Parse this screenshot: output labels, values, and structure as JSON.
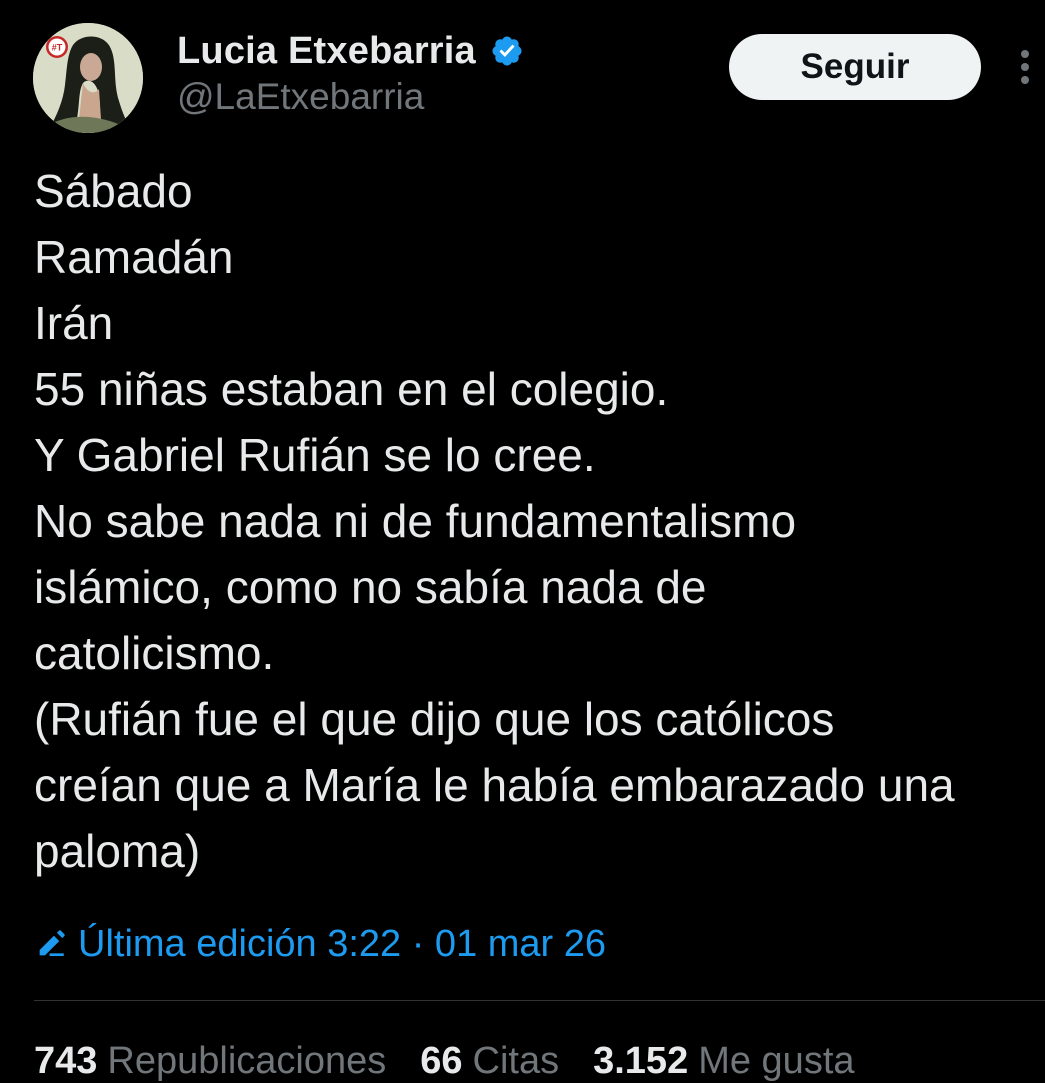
{
  "author": {
    "display_name": "Lucia Etxebarria",
    "handle": "@LaEtxebarria",
    "verified": true,
    "avatar_badge": "#T"
  },
  "actions": {
    "follow_label": "Seguir",
    "more_icon": "more-vertical-icon"
  },
  "tweet": {
    "lines": [
      "Sábado",
      "Ramadán",
      "Irán",
      "55 niñas estaban en el colegio.",
      "Y Gabriel Rufián se lo cree.",
      "No sabe nada ni de fundamentalismo",
      "islámico, como no sabía nada de",
      "catolicismo.",
      "(Rufián fue el que dijo que los católicos",
      "creían que a María le había embarazado una",
      "paloma)"
    ],
    "edited_text": "Última edición 3:22 · 01 mar 26"
  },
  "stats": [
    {
      "count": "743",
      "label": "Republicaciones"
    },
    {
      "count": "66",
      "label": "Citas"
    },
    {
      "count": "3.152",
      "label": "Me gusta"
    }
  ],
  "colors": {
    "background": "#000000",
    "text_primary": "#e7e9ea",
    "text_secondary": "#71767b",
    "accent": "#1d9bf0",
    "divider": "#2f3336",
    "follow_bg": "#eff3f4"
  }
}
